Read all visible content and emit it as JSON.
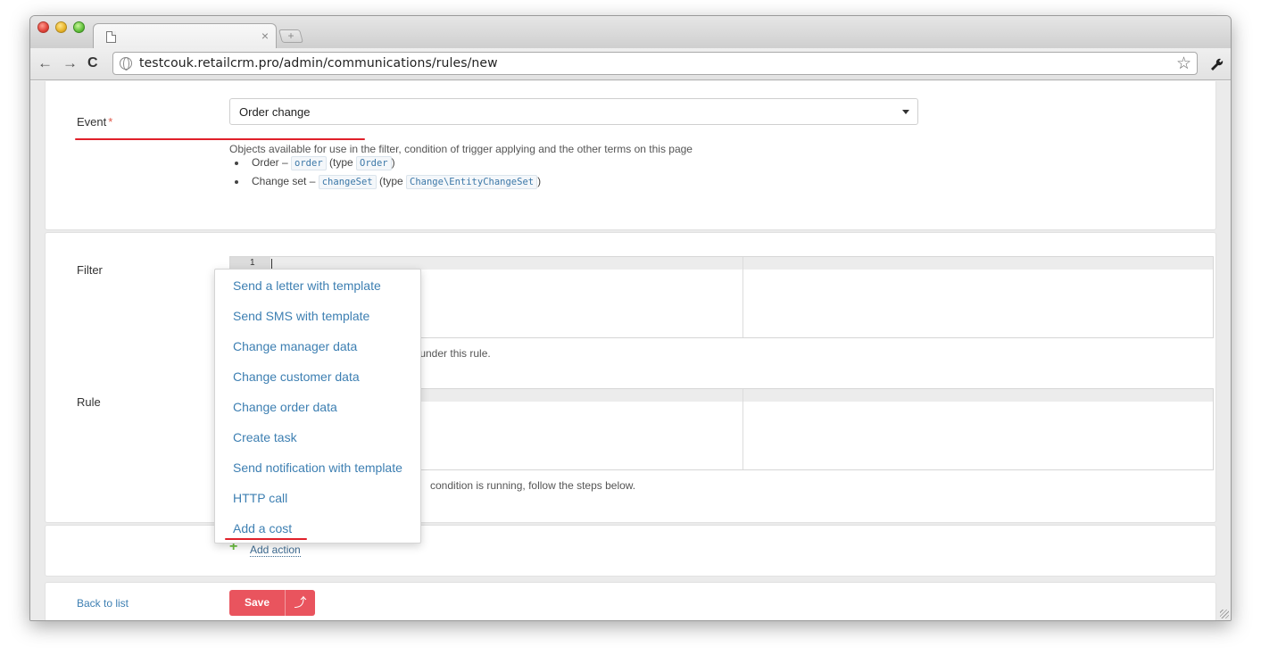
{
  "browser": {
    "url": "testcouk.retailcrm.pro/admin/communications/rules/new",
    "tab_close": "×",
    "new_tab": "+",
    "back": "←",
    "forward": "→",
    "reload": "C",
    "star": "☆",
    "wrench": "🔧"
  },
  "event": {
    "label": "Event",
    "required_mark": "*",
    "selected": "Order change",
    "help": "Objects available for use in the filter, condition of trigger applying and the other terms on this page",
    "objects": [
      {
        "name": "Order –",
        "code": "order",
        "type_prefix": "(type",
        "type": "Order",
        "suffix": ")"
      },
      {
        "name": "Change set –",
        "code": "changeSet",
        "type_prefix": "(type",
        "type": "Change\\EntityChangeSet",
        "suffix": ")"
      }
    ]
  },
  "filter": {
    "label": "Filter",
    "line_number": "1",
    "help_tail": "s under this rule."
  },
  "rule": {
    "label": "Rule",
    "help_tail": "condition is running, follow the steps below."
  },
  "actions_menu": {
    "items": [
      "Send a letter with template",
      "Send SMS with template",
      "Change manager data",
      "Change customer data",
      "Change order data",
      "Create task",
      "Send notification with template",
      "HTTP call",
      "Add a cost"
    ]
  },
  "add_action": {
    "icon": "+",
    "label": "Add action"
  },
  "footer": {
    "back_label": "Back to list",
    "save_label": "Save",
    "save_up_icon": "⤴"
  },
  "colors": {
    "accent_red": "#e9545e",
    "link_blue": "#3d7fb2",
    "annotation_red": "#e0202a"
  }
}
